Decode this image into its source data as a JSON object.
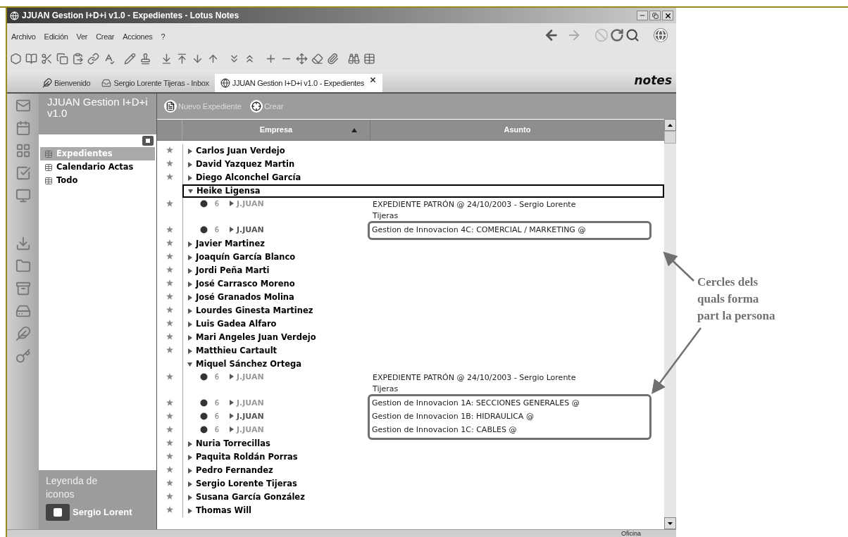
{
  "window": {
    "title": "JJUAN Gestion I+D+i v1.0 - Expedientes - Lotus Notes"
  },
  "menu": [
    "Archivo",
    "Edición",
    "Ver",
    "Crear",
    "Acciones",
    "?"
  ],
  "tabs": [
    {
      "label": "Bienvenido",
      "selected": false,
      "closable": false
    },
    {
      "label": "Sergio Lorente Tijeras - Inbox",
      "selected": false,
      "closable": false
    },
    {
      "label": "JJUAN Gestion I+D+i v1.0 - Expedientes",
      "selected": true,
      "closable": true
    }
  ],
  "brand": "notes",
  "navigator": {
    "title": "JJUAN Gestion I+D+i v1.0",
    "items": [
      {
        "label": "Expedientes",
        "selected": true
      },
      {
        "label": "Calendario Actas",
        "selected": false
      },
      {
        "label": "Todo",
        "selected": false
      }
    ],
    "legend_title": "Leyenda de iconos",
    "user": "Sergio Lorent"
  },
  "actions": [
    {
      "label": "Nuevo Expediente",
      "kind": "new"
    },
    {
      "label": "Crear",
      "kind": "create"
    }
  ],
  "columns": [
    {
      "label": "Empresa",
      "sorted": true
    },
    {
      "label": "Asunto",
      "sorted": false
    }
  ],
  "rows": [
    {
      "kind": "category",
      "name": "Carlos Juan Verdejo",
      "expanded": false,
      "starred": true,
      "selected": false
    },
    {
      "kind": "category",
      "name": "David Yazquez Martin",
      "expanded": false,
      "starred": true,
      "selected": false
    },
    {
      "kind": "category",
      "name": "Diego Alconchel García",
      "expanded": false,
      "starred": true,
      "selected": false
    },
    {
      "kind": "category",
      "name": "Heike Ligensa",
      "expanded": true,
      "starred": false,
      "selected": true,
      "children": [
        {
          "count": "6",
          "author": "J.JUAN",
          "subject": "EXPEDIENTE PATRÓN @ 24/10/2003 - Sergio Lorente Tijeras",
          "starred": true,
          "dimmed": true,
          "framed": false
        },
        {
          "count": "6",
          "author": "J.JUAN",
          "subject": "Gestion de Innovacion 4C: COMERCIAL / MARKETING @",
          "starred": true,
          "dimmed": false,
          "framed": true
        }
      ]
    },
    {
      "kind": "category",
      "name": "Javier Martinez",
      "expanded": false,
      "starred": true,
      "selected": false
    },
    {
      "kind": "category",
      "name": "Joaquín García Blanco",
      "expanded": false,
      "starred": true,
      "selected": false
    },
    {
      "kind": "category",
      "name": "Jordi Peña Marti",
      "expanded": false,
      "starred": true,
      "selected": false
    },
    {
      "kind": "category",
      "name": "José Carrasco Moreno",
      "expanded": false,
      "starred": true,
      "selected": false
    },
    {
      "kind": "category",
      "name": "José Granados Molina",
      "expanded": false,
      "starred": true,
      "selected": false
    },
    {
      "kind": "category",
      "name": "Lourdes Ginesta Martinez",
      "expanded": false,
      "starred": true,
      "selected": false
    },
    {
      "kind": "category",
      "name": "Luis Gadea Alfaro",
      "expanded": false,
      "starred": true,
      "selected": false
    },
    {
      "kind": "category",
      "name": "Mari Angeles Juan Verdejo",
      "expanded": false,
      "starred": true,
      "selected": false
    },
    {
      "kind": "category",
      "name": "Matthieu Cartault",
      "expanded": false,
      "starred": true,
      "selected": false
    },
    {
      "kind": "category",
      "name": "Miquel Sánchez Ortega",
      "expanded": true,
      "starred": false,
      "selected": false,
      "children": [
        {
          "count": "6",
          "author": "J.JUAN",
          "subject": "EXPEDIENTE PATRÓN @ 24/10/2003 - Sergio Lorente Tijeras",
          "starred": true,
          "dimmed": true,
          "framed": false
        },
        {
          "count": "6",
          "author": "J.JUAN",
          "subject": "Gestion de Innovacion 1A: SECCIONES GENERALES @",
          "starred": true,
          "dimmed": true,
          "framed": true
        },
        {
          "count": "6",
          "author": "J.JUAN",
          "subject": "Gestion de Innovacion 1B: HIDRAULICA @",
          "starred": true,
          "dimmed": false,
          "framed": true
        },
        {
          "count": "6",
          "author": "J.JUAN",
          "subject": "Gestion de Innovacion 1C: CABLES @",
          "starred": true,
          "dimmed": true,
          "framed": true
        }
      ]
    },
    {
      "kind": "category",
      "name": "Nuria Torrecillas",
      "expanded": false,
      "starred": true,
      "selected": false
    },
    {
      "kind": "category",
      "name": "Paquita Roldán Porras",
      "expanded": false,
      "starred": true,
      "selected": false
    },
    {
      "kind": "category",
      "name": "Pedro Fernandez",
      "expanded": false,
      "starred": true,
      "selected": false
    },
    {
      "kind": "category",
      "name": "Sergio Lorente Tijeras",
      "expanded": false,
      "starred": true,
      "selected": false
    },
    {
      "kind": "category",
      "name": "Susana García González",
      "expanded": false,
      "starred": true,
      "selected": false
    },
    {
      "kind": "category",
      "name": "Thomas Will",
      "expanded": false,
      "starred": true,
      "selected": false
    }
  ],
  "status_bar": {
    "location": "Oficina"
  },
  "annotation": {
    "lines": [
      "Cercles dels",
      "quals forma",
      "part la persona"
    ]
  }
}
